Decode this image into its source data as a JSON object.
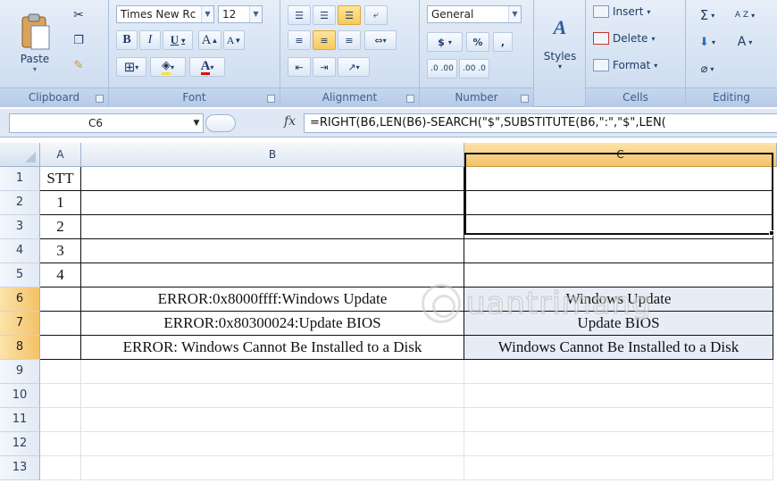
{
  "ribbon": {
    "clipboard": {
      "label": "Clipboard",
      "paste": "Paste"
    },
    "font": {
      "label": "Font",
      "name": "Times New Rc",
      "size": "12",
      "bold": "B",
      "italic": "I",
      "underline": "U",
      "grow": "A",
      "shrink": "A",
      "text_color_letter": "A"
    },
    "alignment": {
      "label": "Alignment"
    },
    "number": {
      "label": "Number",
      "format": "General",
      "currency": "$",
      "percent": "%",
      "comma": ",",
      "inc_decimal": ".0 .00",
      "dec_decimal": ".00 .0"
    },
    "styles": {
      "label": "Styles"
    },
    "cells": {
      "label": "Cells",
      "insert": "Insert",
      "delete": "Delete",
      "format": "Format"
    },
    "editing": {
      "label": "Editing",
      "sum": "Σ",
      "sort": "A Z",
      "find": "A"
    }
  },
  "formula_bar": {
    "name_box": "C6",
    "fx": "fx",
    "formula": "=RIGHT(B6,LEN(B6)-SEARCH(\"$\",SUBSTITUTE(B6,\":\",\"$\",LEN("
  },
  "grid": {
    "columns": [
      "A",
      "B",
      "C"
    ],
    "rows": [
      {
        "num": "1",
        "a": "STT",
        "b": "",
        "c": ""
      },
      {
        "num": "2",
        "a": "1",
        "b": "",
        "c": ""
      },
      {
        "num": "3",
        "a": "2",
        "b": "",
        "c": ""
      },
      {
        "num": "4",
        "a": "3",
        "b": "",
        "c": ""
      },
      {
        "num": "5",
        "a": "4",
        "b": "",
        "c": ""
      },
      {
        "num": "6",
        "a": "",
        "b": "ERROR:0x8000ffff:Windows Update",
        "c": "Windows Update"
      },
      {
        "num": "7",
        "a": "",
        "b": "ERROR:0x80300024:Update BIOS",
        "c": "Update BIOS"
      },
      {
        "num": "8",
        "a": "",
        "b": "ERROR: Windows Cannot Be Installed to a Disk",
        "c": "Windows Cannot Be Installed to a Disk"
      },
      {
        "num": "9",
        "a": "",
        "b": "",
        "c": ""
      },
      {
        "num": "10",
        "a": "",
        "b": "",
        "c": ""
      },
      {
        "num": "11",
        "a": "",
        "b": "",
        "c": ""
      },
      {
        "num": "12",
        "a": "",
        "b": "",
        "c": ""
      },
      {
        "num": "13",
        "a": "",
        "b": "",
        "c": ""
      }
    ]
  },
  "watermark": {
    "text": "uantrimang"
  },
  "colors": {
    "selection_header": "#f3c268",
    "ribbon_bg": "#d6e3f3",
    "selected_cell_bg": "#e7ecf6"
  }
}
